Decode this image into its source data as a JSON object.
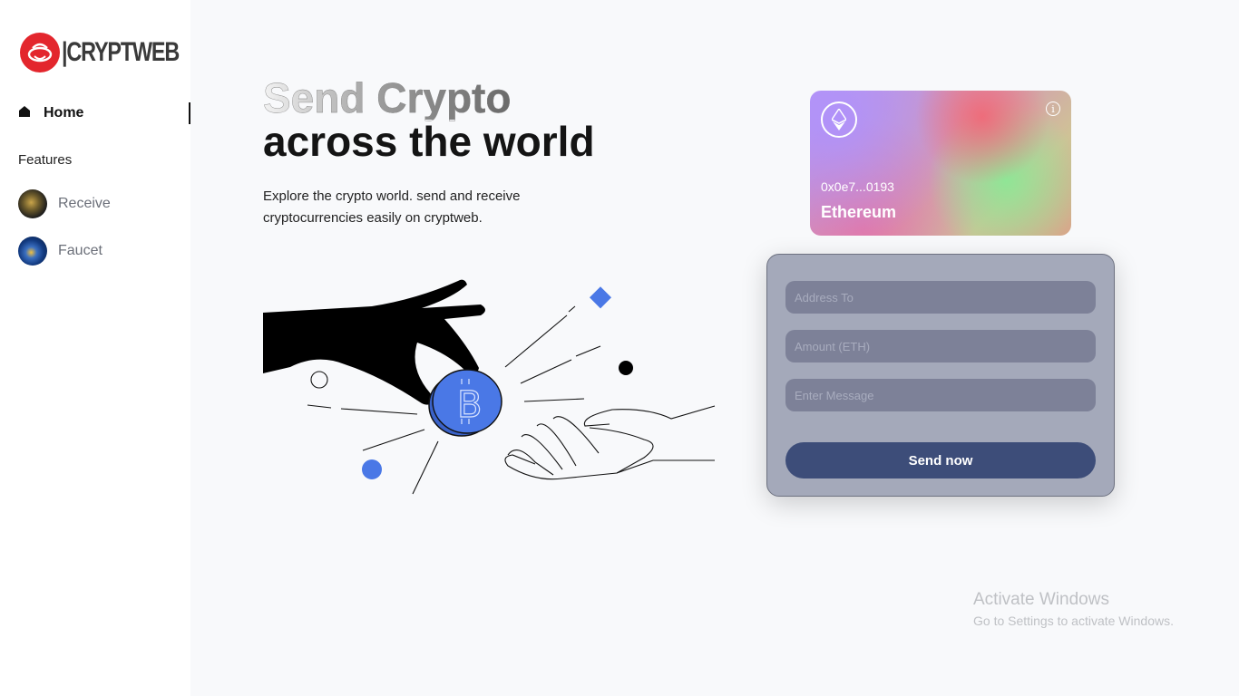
{
  "brand": {
    "name": "|CRYPTWEB"
  },
  "sidebar": {
    "home_label": "Home",
    "section_label": "Features",
    "items": [
      {
        "label": "Receive",
        "icon": "receive-avatar-icon"
      },
      {
        "label": "Faucet",
        "icon": "faucet-avatar-icon"
      }
    ]
  },
  "hero": {
    "title_line1": "Send Crypto",
    "title_line2": "across the world",
    "description": "Explore the crypto world. send and receive cryptocurrencies easily on cryptweb."
  },
  "card": {
    "address": "0x0e7...0193",
    "network": "Ethereum",
    "info_icon": "info-icon",
    "eth_icon": "ethereum-icon"
  },
  "form": {
    "address_placeholder": "Address To",
    "amount_placeholder": "Amount (ETH)",
    "message_placeholder": "Enter Message",
    "submit_label": "Send now"
  },
  "watermark": {
    "title": "Activate Windows",
    "subtitle": "Go to Settings to activate Windows."
  },
  "colors": {
    "accent": "#3d4d79",
    "coin_blue": "#4a78e6",
    "logo_red": "#e3262d"
  }
}
